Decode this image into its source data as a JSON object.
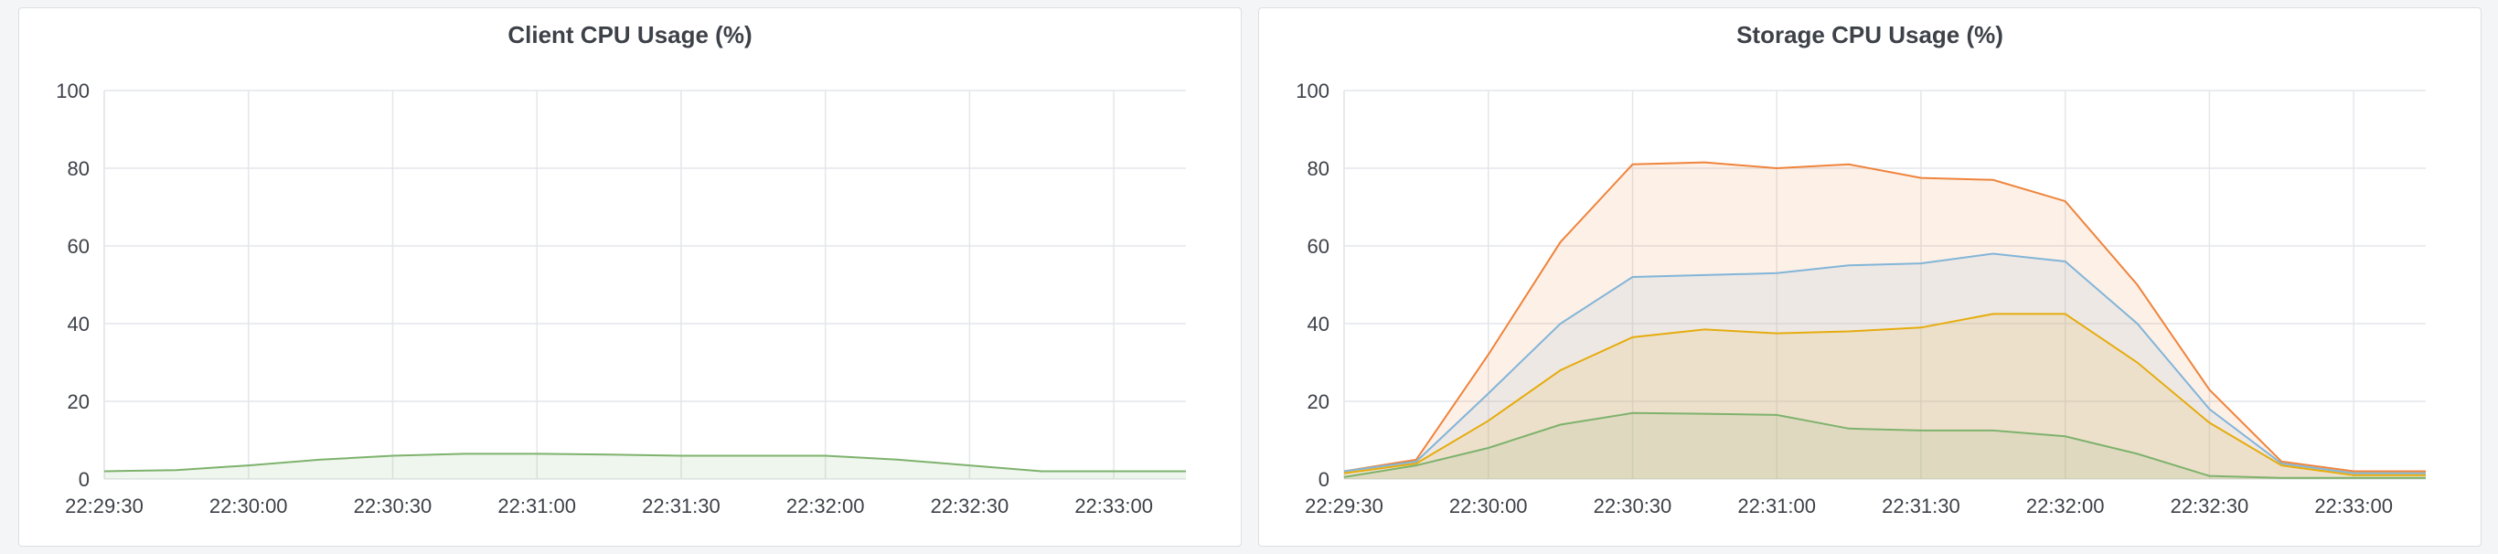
{
  "chart_data": [
    {
      "type": "area",
      "title": "Client CPU Usage (%)",
      "xlabel": "",
      "ylabel": "",
      "ylim": [
        0,
        100
      ],
      "yticks": [
        0,
        20,
        40,
        60,
        80,
        100
      ],
      "xticks": [
        "22:29:30",
        "22:30:00",
        "22:30:30",
        "22:31:00",
        "22:31:30",
        "22:32:00",
        "22:32:30",
        "22:33:00"
      ],
      "x": [
        "22:29:30",
        "22:29:45",
        "22:30:00",
        "22:30:15",
        "22:30:30",
        "22:30:45",
        "22:31:00",
        "22:31:15",
        "22:31:30",
        "22:31:45",
        "22:32:00",
        "22:32:15",
        "22:32:30",
        "22:32:45",
        "22:33:00",
        "22:33:15"
      ],
      "series": [
        {
          "color": "#7eb26d",
          "values": [
            2,
            2.3,
            3.5,
            5,
            6,
            6.5,
            6.5,
            6.3,
            6,
            6,
            6,
            5,
            3.5,
            2,
            2,
            2
          ]
        }
      ],
      "grid": true
    },
    {
      "type": "area",
      "title": "Storage CPU Usage (%)",
      "xlabel": "",
      "ylabel": "",
      "ylim": [
        0,
        100
      ],
      "yticks": [
        0,
        20,
        40,
        60,
        80,
        100
      ],
      "xticks": [
        "22:29:30",
        "22:30:00",
        "22:30:30",
        "22:31:00",
        "22:31:30",
        "22:32:00",
        "22:32:30",
        "22:33:00"
      ],
      "x": [
        "22:29:30",
        "22:29:45",
        "22:30:00",
        "22:30:15",
        "22:30:30",
        "22:30:45",
        "22:31:00",
        "22:31:15",
        "22:31:30",
        "22:31:45",
        "22:32:00",
        "22:32:15",
        "22:32:30",
        "22:32:45",
        "22:33:00",
        "22:33:15"
      ],
      "series": [
        {
          "color": "#ef843c",
          "values": [
            2,
            5,
            32,
            61,
            81,
            81.5,
            80,
            81,
            77.5,
            77,
            71.5,
            50,
            23,
            4.5,
            2,
            2
          ]
        },
        {
          "color": "#82b5d8",
          "values": [
            2,
            4.5,
            22,
            40,
            52,
            52.5,
            53,
            55,
            55.5,
            58,
            56,
            40,
            18,
            4,
            1.5,
            1.5
          ]
        },
        {
          "color": "#e5ac0e",
          "values": [
            1.5,
            4,
            15,
            28,
            36.5,
            38.5,
            37.5,
            38,
            39,
            42.5,
            42.5,
            30,
            14.5,
            3.5,
            1,
            1
          ]
        },
        {
          "color": "#7eb26d",
          "values": [
            0.5,
            3.5,
            8,
            14,
            17,
            16.8,
            16.5,
            13,
            12.5,
            12.5,
            11,
            6.5,
            0.8,
            0.3,
            0.3,
            0.3
          ]
        }
      ],
      "grid": true
    }
  ]
}
